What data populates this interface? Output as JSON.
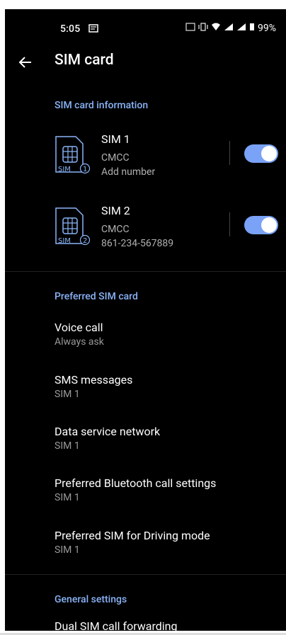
{
  "status": {
    "time": "5:05",
    "battery": "99%"
  },
  "appbar": {
    "title": "SIM card"
  },
  "sim_info": {
    "header": "SIM card information",
    "sims": [
      {
        "title": "SIM 1",
        "carrier": "CMCC",
        "number": "Add number",
        "icon_label": "SIM",
        "icon_num": "1",
        "enabled": true
      },
      {
        "title": "SIM 2",
        "carrier": "CMCC",
        "number": "861-234-567889",
        "icon_label": "SIM",
        "icon_num": "2",
        "enabled": true
      }
    ]
  },
  "preferred": {
    "header": "Preferred SIM card",
    "items": [
      {
        "title": "Voice call",
        "value": "Always ask"
      },
      {
        "title": "SMS messages",
        "value": "SIM 1"
      },
      {
        "title": "Data service network",
        "value": "SIM 1"
      },
      {
        "title": "Preferred Bluetooth call settings",
        "value": "SIM 1"
      },
      {
        "title": "Preferred SIM for Driving mode",
        "value": "SIM 1"
      }
    ]
  },
  "general": {
    "header": "General settings",
    "items": [
      {
        "title": "Dual SIM call forwarding"
      }
    ]
  },
  "colors": {
    "accent": "#8ab4f8",
    "switch_track": "#7aa2f7",
    "background": "#000000"
  }
}
